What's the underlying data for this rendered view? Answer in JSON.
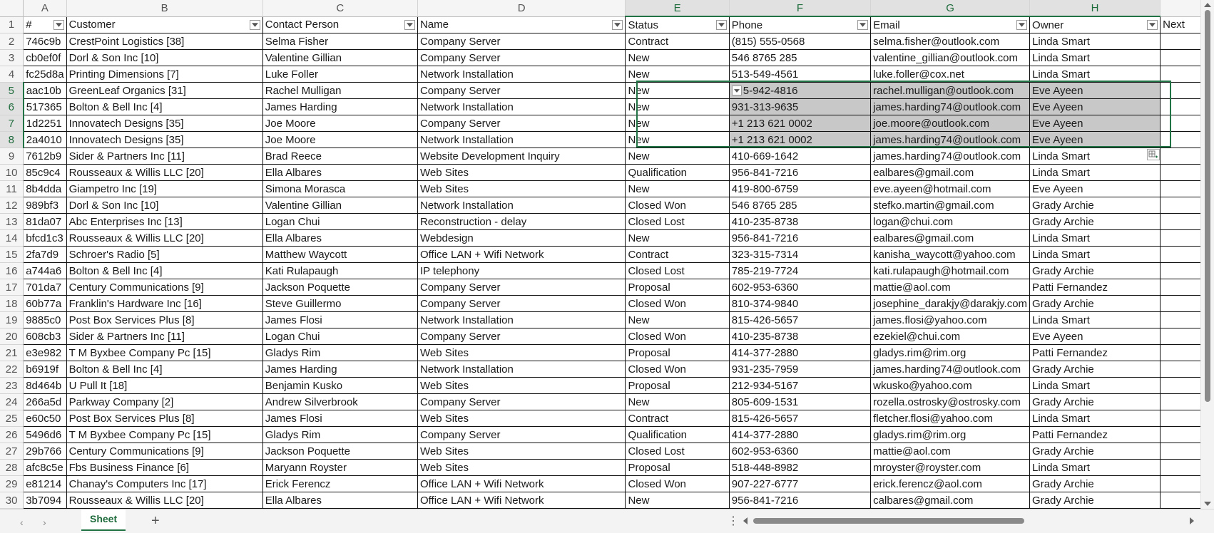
{
  "columns": [
    "A",
    "B",
    "C",
    "D",
    "E",
    "F",
    "G",
    "H",
    ""
  ],
  "header_row_number": "1",
  "headers": [
    "#",
    "Customer",
    "Contact Person",
    "Name",
    "Status",
    "Phone",
    "Email",
    "Owner",
    "Next"
  ],
  "rows": [
    {
      "n": "2",
      "cells": [
        "746c9b",
        "CrestPoint Logistics [38]",
        "Selma Fisher",
        "Company Server",
        "Contract",
        "(815) 555-0568",
        "selma.fisher@outlook.com",
        "Linda Smart"
      ]
    },
    {
      "n": "3",
      "cells": [
        "cb0ef0f",
        "Dorl & Son Inc [10]",
        "Valentine Gillian",
        "Company Server",
        "New",
        "546 8765 285",
        "valentine_gillian@outlook.com",
        "Linda Smart"
      ]
    },
    {
      "n": "4",
      "cells": [
        "fc25d8a",
        "Printing Dimensions [7]",
        "Luke Foller",
        "Network Installation",
        "New",
        "513-549-4561",
        "luke.foller@cox.net",
        "Linda Smart"
      ]
    },
    {
      "n": "5",
      "cells": [
        "aac10b",
        "GreenLeaf Organics [31]",
        "Rachel Mulligan",
        "Company Server",
        "New",
        "5-942-4816",
        "rachel.mulligan@outlook.com",
        "Eve Ayeen"
      ]
    },
    {
      "n": "6",
      "cells": [
        "517365",
        "Bolton & Bell Inc [4]",
        "James Harding",
        "Network Installation",
        "New",
        "931-313-9635",
        "james.harding74@outlook.com",
        "Eve Ayeen"
      ]
    },
    {
      "n": "7",
      "cells": [
        "1d2251",
        "Innovatech Designs [35]",
        "Joe Moore",
        "Company Server",
        "New",
        "+1 213 621 0002",
        "joe.moore@outlook.com",
        "Eve Ayeen"
      ]
    },
    {
      "n": "8",
      "cells": [
        "2a4010",
        "Innovatech Designs [35]",
        "Joe Moore",
        "Network Installation",
        "New",
        "+1 213 621 0002",
        "james.harding74@outlook.com",
        "Eve Ayeen"
      ]
    },
    {
      "n": "9",
      "cells": [
        "7612b9",
        "Sider & Partners Inc [11]",
        "Brad Reece",
        "Website Development Inquiry",
        "New",
        "410-669-1642",
        "james.harding74@outlook.com",
        "Linda Smart"
      ]
    },
    {
      "n": "10",
      "cells": [
        "85c9c4",
        "Rousseaux & Willis LLC [20]",
        "Ella Albares",
        "Web Sites",
        "Qualification",
        "956-841-7216",
        "ealbares@gmail.com",
        "Linda Smart"
      ]
    },
    {
      "n": "11",
      "cells": [
        "8b4dda",
        "Giampetro Inc [19]",
        "Simona Morasca",
        "Web Sites",
        "New",
        "419-800-6759",
        "eve.ayeen@hotmail.com",
        "Eve Ayeen"
      ]
    },
    {
      "n": "12",
      "cells": [
        "989bf3",
        "Dorl & Son Inc [10]",
        "Valentine Gillian",
        "Network Installation",
        "Closed Won",
        "546 8765 285",
        "stefko.martin@gmail.com",
        "Grady Archie"
      ]
    },
    {
      "n": "13",
      "cells": [
        "81da07",
        "Abc Enterprises Inc [13]",
        "Logan Chui",
        "Reconstruction - delay",
        "Closed Lost",
        "410-235-8738",
        "logan@chui.com",
        "Grady Archie"
      ]
    },
    {
      "n": "14",
      "cells": [
        "bfcd1c3",
        "Rousseaux & Willis LLC [20]",
        "Ella Albares",
        "Webdesign",
        "New",
        "956-841-7216",
        "ealbares@gmail.com",
        "Linda Smart"
      ]
    },
    {
      "n": "15",
      "cells": [
        "2fa7d9",
        "Schroer's Radio [5]",
        "Matthew Waycott",
        "Office LAN + Wifi Network",
        "Contract",
        "323-315-7314",
        "kanisha_waycott@yahoo.com",
        "Linda Smart"
      ]
    },
    {
      "n": "16",
      "cells": [
        "a744a6",
        "Bolton & Bell Inc [4]",
        "Kati Rulapaugh",
        "IP telephony",
        "Closed Lost",
        "785-219-7724",
        "kati.rulapaugh@hotmail.com",
        "Grady Archie"
      ]
    },
    {
      "n": "17",
      "cells": [
        "701da7",
        "Century Communications [9]",
        "Jackson Poquette",
        "Company Server",
        "Proposal",
        "602-953-6360",
        "mattie@aol.com",
        "Patti Fernandez"
      ]
    },
    {
      "n": "18",
      "cells": [
        "60b77a",
        "Franklin's Hardware Inc [16]",
        "Steve Guillermo",
        "Company Server",
        "Closed Won",
        "810-374-9840",
        "josephine_darakjy@darakjy.com",
        "Grady Archie"
      ]
    },
    {
      "n": "19",
      "cells": [
        "9885c0",
        "Post Box Services Plus [8]",
        "James Flosi",
        "Network Installation",
        "New",
        "815-426-5657",
        "james.flosi@yahoo.com",
        "Linda Smart"
      ]
    },
    {
      "n": "20",
      "cells": [
        "608cb3",
        "Sider & Partners Inc [11]",
        "Logan Chui",
        "Company Server",
        "Closed Won",
        "410-235-8738",
        "ezekiel@chui.com",
        "Eve Ayeen"
      ]
    },
    {
      "n": "21",
      "cells": [
        "e3e982",
        "T M Byxbee Company Pc [15]",
        "Gladys Rim",
        "Web Sites",
        "Proposal",
        "414-377-2880",
        "gladys.rim@rim.org",
        "Patti Fernandez"
      ]
    },
    {
      "n": "22",
      "cells": [
        "b6919f",
        "Bolton & Bell Inc [4]",
        "James Harding",
        "Network Installation",
        "Closed Won",
        "931-235-7959",
        "james.harding74@outlook.com",
        "Grady Archie"
      ]
    },
    {
      "n": "23",
      "cells": [
        "8d464b",
        "U Pull It [18]",
        "Benjamin Kusko",
        "Web Sites",
        "Proposal",
        "212-934-5167",
        "wkusko@yahoo.com",
        "Linda Smart"
      ]
    },
    {
      "n": "24",
      "cells": [
        "266a5d",
        "Parkway Company [2]",
        "Andrew Silverbrook",
        "Company Server",
        "New",
        "805-609-1531",
        "rozella.ostrosky@ostrosky.com",
        "Grady Archie"
      ]
    },
    {
      "n": "25",
      "cells": [
        "e60c50",
        "Post Box Services Plus [8]",
        "James Flosi",
        "Web Sites",
        "Contract",
        "815-426-5657",
        "fletcher.flosi@yahoo.com",
        "Linda Smart"
      ]
    },
    {
      "n": "26",
      "cells": [
        "5496d6",
        "T M Byxbee Company Pc [15]",
        "Gladys Rim",
        "Company Server",
        "Qualification",
        "414-377-2880",
        "gladys.rim@rim.org",
        "Patti Fernandez"
      ]
    },
    {
      "n": "27",
      "cells": [
        "29b766",
        "Century Communications [9]",
        "Jackson Poquette",
        "Web Sites",
        "Closed Lost",
        "602-953-6360",
        "mattie@aol.com",
        "Grady Archie"
      ]
    },
    {
      "n": "28",
      "cells": [
        "afc8c5e",
        "Fbs Business Finance [6]",
        "Maryann Royster",
        "Web Sites",
        "Proposal",
        "518-448-8982",
        "mroyster@royster.com",
        "Linda Smart"
      ]
    },
    {
      "n": "29",
      "cells": [
        "e81214",
        "Chanay's Computers Inc [17]",
        "Erick Ferencz",
        "Office LAN + Wifi Network",
        "Closed Won",
        "907-227-6777",
        "erick.ferencz@aol.com",
        "Grady Archie"
      ]
    },
    {
      "n": "30",
      "cells": [
        "3b7094",
        "Rousseaux & Willis LLC [20]",
        "Ella Albares",
        "Office LAN + Wifi Network",
        "New",
        "956-841-7216",
        "calbares@gmail.com",
        "Grady Archie"
      ]
    }
  ],
  "sheet_tab": "Sheet",
  "add_sheet_label": "+",
  "more_label": "⋮",
  "colors": {
    "accent": "#217346",
    "highlight": "#c8c8c8"
  }
}
